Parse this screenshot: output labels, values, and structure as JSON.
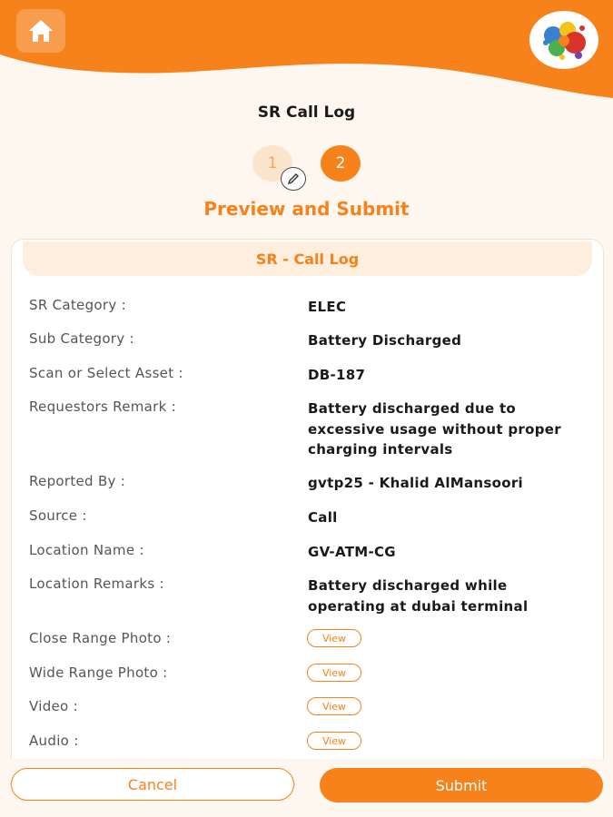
{
  "header": {
    "home_icon": "home-icon",
    "logo_icon": "paint-splash-logo"
  },
  "page": {
    "title": "SR Call Log",
    "steps": [
      {
        "label": "1",
        "state": "completed",
        "badge_icon": "pencil-icon"
      },
      {
        "label": "2",
        "state": "active"
      }
    ],
    "section_heading": "Preview and Submit"
  },
  "card": {
    "title": "SR - Call Log",
    "fields": [
      {
        "label": "SR Category :",
        "value": "ELEC"
      },
      {
        "label": "Sub Category :",
        "value": "Battery Discharged"
      },
      {
        "label": "Scan or Select Asset :",
        "value": "DB-187"
      },
      {
        "label": "Requestors Remark :",
        "value_lines": [
          "Battery discharged due to",
          "excessive usage without proper",
          "charging intervals"
        ]
      },
      {
        "label": "Reported By :",
        "value": "gvtp25 - Khalid AlMansoori"
      },
      {
        "label": "Source :",
        "value": "Call"
      },
      {
        "label": "Location Name :",
        "value": "GV-ATM-CG"
      },
      {
        "label": "Location Remarks :",
        "value_lines": [
          "Battery discharged while",
          "operating at dubai terminal"
        ]
      },
      {
        "label": "Close Range Photo :",
        "action": "View"
      },
      {
        "label": "Wide Range Photo :",
        "action": "View"
      },
      {
        "label": "Video :",
        "action": "View"
      },
      {
        "label": "Audio :",
        "action": "View"
      }
    ]
  },
  "footer": {
    "cancel_label": "Cancel",
    "submit_label": "Submit"
  },
  "colors": {
    "accent": "#f7821b",
    "accent_light": "#fdeedd",
    "background": "#fdf7ef"
  }
}
